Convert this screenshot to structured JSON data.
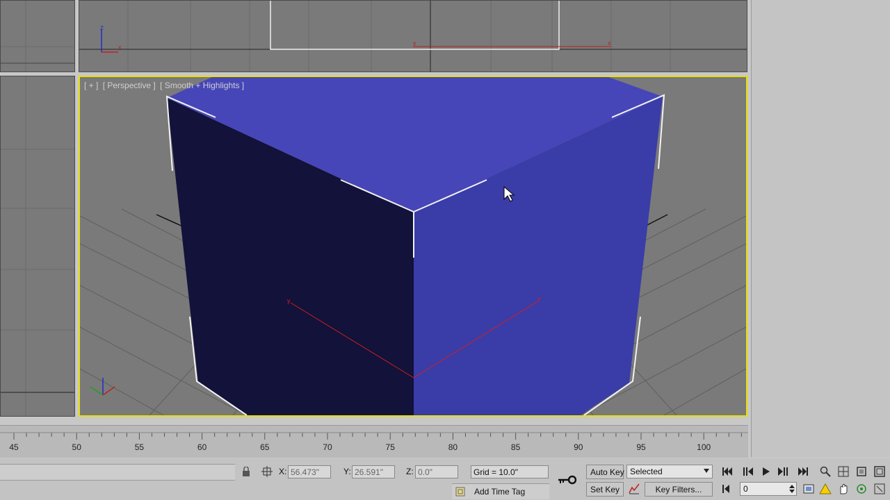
{
  "viewport_perspective": {
    "label_plus": "[ + ]",
    "label_view": "[ Perspective ]",
    "label_shading": "[ Smooth + Highlights ]"
  },
  "viewport_top": {
    "axis_labels": {
      "y": "y",
      "x": "x",
      "z": "z",
      "x2": "x"
    }
  },
  "gizmo": {
    "x": "x",
    "y": "y"
  },
  "timeline": {
    "ticks": [
      "45",
      "50",
      "55",
      "60",
      "65",
      "70",
      "75",
      "80",
      "85",
      "90",
      "95",
      "100"
    ]
  },
  "status": {
    "x_label": "X:",
    "x_value": "56.473\"",
    "y_label": "Y:",
    "y_value": "26.591\"",
    "z_label": "Z:",
    "z_value": "0.0\"",
    "grid": "Grid = 10.0\"",
    "add_time_tag": "Add Time Tag",
    "auto_key": "Auto Key",
    "set_key": "Set Key",
    "selected_dropdown": "Selected",
    "key_filters": "Key Filters...",
    "frame_value": "0"
  },
  "colors": {
    "active_viewport_border": "#e8e000",
    "box_top": "#4646b8",
    "box_left": "#12123a",
    "box_right": "#3a3ca8",
    "viewport_bg": "#7a7a7a"
  },
  "icons": {
    "lock": "lock-icon",
    "absolute_mode": "transform-mode-icon",
    "key": "key-icon",
    "curve": "curve-editor-icon",
    "goto_start": "goto-start-icon",
    "prev_frame": "previous-frame-icon",
    "play": "play-icon",
    "next_frame": "next-frame-icon",
    "goto_end": "goto-end-icon",
    "zoom": "zoom-icon",
    "zoom_all": "zoom-all-icon",
    "zoom_extents": "zoom-extents-icon",
    "maximize": "maximize-viewport-icon",
    "pan": "pan-icon",
    "orbit": "orbit-icon",
    "field_of_view": "field-of-view-icon",
    "key_mode": "key-mode-icon",
    "time_config": "time-config-icon"
  }
}
